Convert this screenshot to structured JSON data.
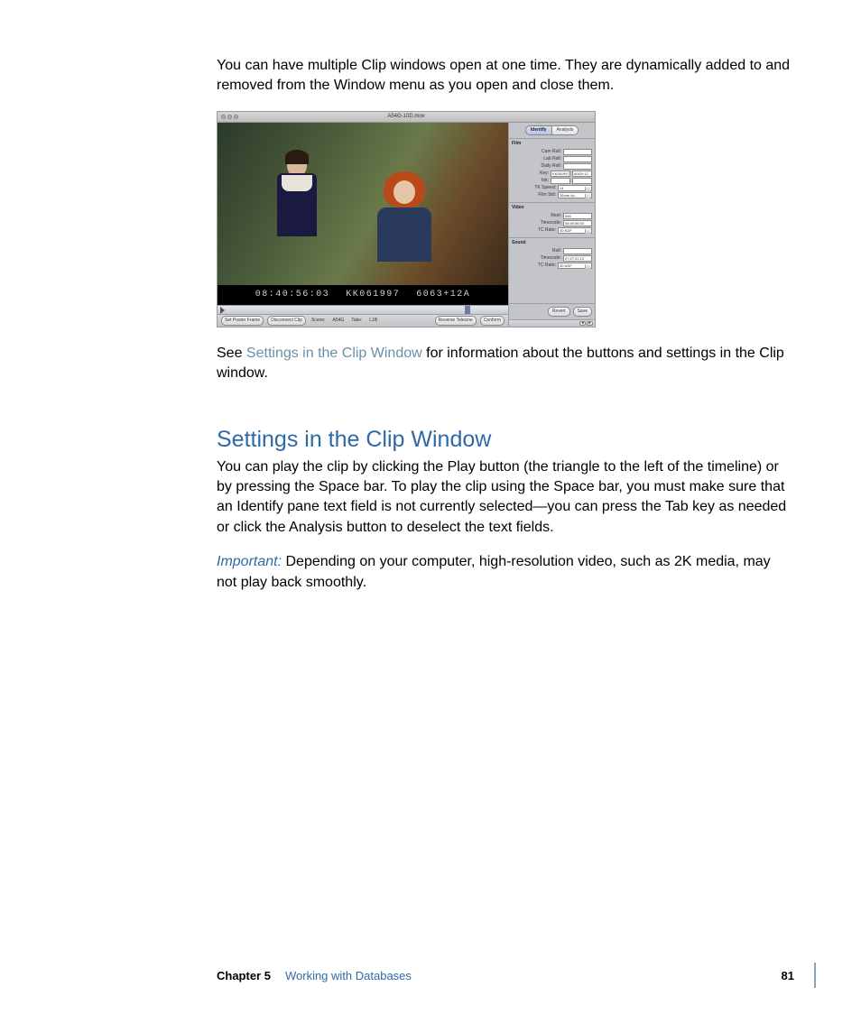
{
  "body": {
    "para1": "You can have multiple Clip windows open at one time. They are dynamically added to and removed from the Window menu as you open and close them.",
    "para2_pre": "See ",
    "para2_link": "Settings in the Clip Window",
    "para2_post": " for information about the buttons and settings in the Clip window.",
    "heading": "Settings in the Clip Window",
    "para3": "You can play the clip by clicking the Play button (the triangle to the left of the timeline) or by pressing the Space bar. To play the clip using the Space bar, you must make sure that an Identify pane text field is not currently selected—you can press the Tab key as needed or click the Analysis button to deselect the text fields.",
    "important_label": "Important:  ",
    "para4": "Depending on your computer, high-resolution video, such as 2K media, may not play back smoothly."
  },
  "screenshot": {
    "title": "A54G-10D.mov",
    "burnin_tc": "08:40:56:03",
    "burnin_key": "KK061997",
    "burnin_edge": "6063+12A",
    "bottom": {
      "set_poster": "Set Poster Frame",
      "disconnect": "Disconnect Clip",
      "scene_label": "Scene:",
      "scene_value": "A54G",
      "take_label": "Take:",
      "take_value": "L1B",
      "reverse": "Reverse Telecine",
      "conform": "Conform"
    },
    "tabs": {
      "identify": "Identify",
      "analysis": "Analysis"
    },
    "film": {
      "header": "Film",
      "cam_roll": "Cam Roll:",
      "lab_roll": "Lab Roll:",
      "daily_roll": "Daily Roll:",
      "key": "Key:",
      "key_val1": "KK061997",
      "key_val2": "6063+12",
      "ink": "Ink:",
      "tk_speed": "TK Speed:",
      "tk_speed_val": "24",
      "film_std": "Film Std:",
      "film_std_val": "35mm 4p"
    },
    "video": {
      "header": "Video",
      "reel": "Reel:",
      "reel_val": "056",
      "timecode": "Timecode:",
      "timecode_val": "08:40:56:03",
      "tc_rate": "TC Rate:",
      "tc_rate_val": "30 NDF"
    },
    "sound": {
      "header": "Sound",
      "roll": "Roll:",
      "timecode": "Timecode:",
      "timecode_val": "07:27:41:12",
      "tc_rate": "TC Rate:",
      "tc_rate_val": "30 NDF"
    },
    "buttons": {
      "revert": "Revert",
      "save": "Save"
    }
  },
  "footer": {
    "chapter": "Chapter 5",
    "title": "Working with Databases",
    "page": "81"
  }
}
